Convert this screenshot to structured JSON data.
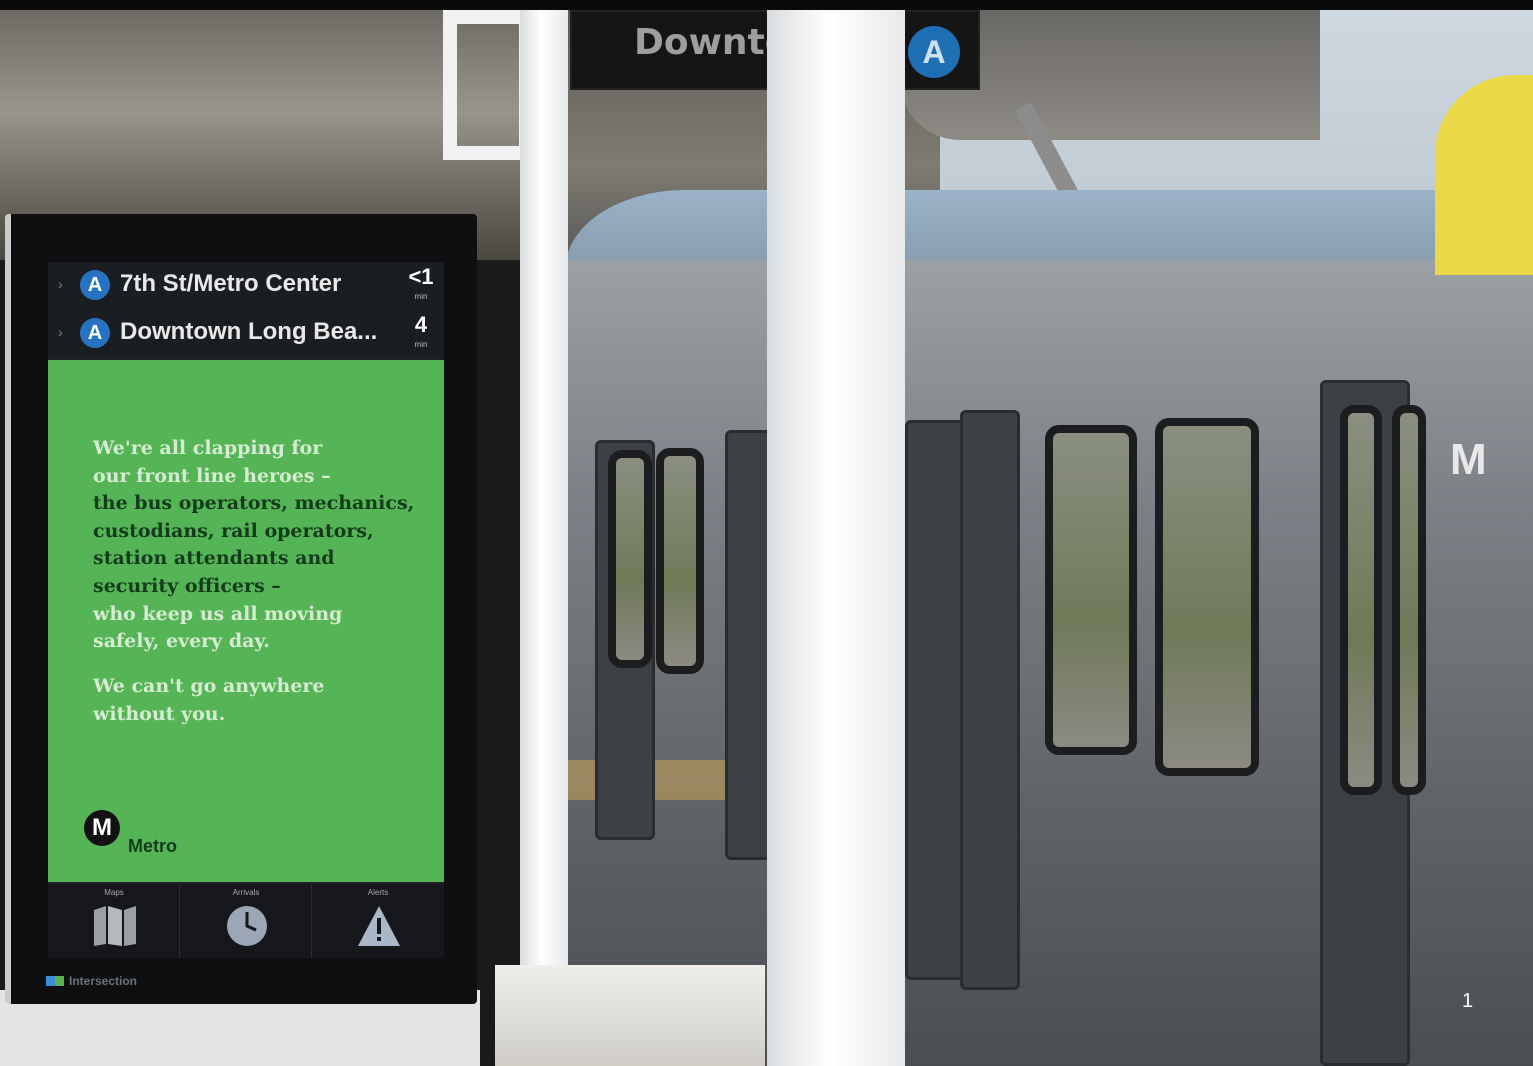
{
  "station_sign": {
    "text": "Downto",
    "line_bullet": "A"
  },
  "kiosk": {
    "arrivals": [
      {
        "line": "A",
        "destination": "7th St/Metro Center",
        "minutes": "<1",
        "unit": "min"
      },
      {
        "line": "A",
        "destination": "Downtown Long Bea...",
        "minutes": "4",
        "unit": "min"
      }
    ],
    "message": {
      "lines_light_top": [
        "We're all clapping for",
        "our front line heroes –"
      ],
      "lines_dark": [
        "the bus operators, mechanics,",
        "custodians, rail operators,",
        "station attendants and",
        "security officers –"
      ],
      "lines_light_bottom": [
        "who keep us all moving",
        "safely, every day."
      ],
      "closing": [
        "We can't go anywhere",
        "without you."
      ]
    },
    "logo": {
      "letter": "M",
      "word": "Metro"
    },
    "nav": [
      {
        "label": "Maps",
        "icon": "map-icon"
      },
      {
        "label": "Arrivals",
        "icon": "clock-icon"
      },
      {
        "label": "Alerts",
        "icon": "alert-icon"
      }
    ],
    "brand": "Intersection"
  },
  "train_logo": "M",
  "page_number": "1",
  "colors": {
    "metro_green": "#55b556",
    "line_a_blue": "#2673c2",
    "train_yellow": "#e9d948"
  }
}
